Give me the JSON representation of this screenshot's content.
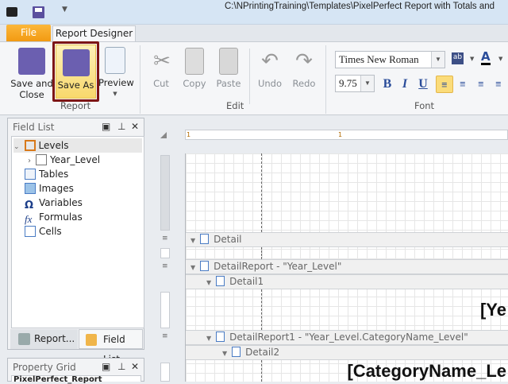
{
  "titlebar": {
    "title": "C:\\NPrintingTraining\\Templates\\PixelPerfect Report with Totals and"
  },
  "tabs": {
    "file": "File",
    "report_designer": "Report Designer"
  },
  "ribbon": {
    "report_group": {
      "label": "Report",
      "save_and_close": "Save and Close",
      "save_as": "Save As",
      "preview": "Preview"
    },
    "edit_group": {
      "label": "Edit",
      "cut": "Cut",
      "copy": "Copy",
      "paste": "Paste",
      "undo": "Undo",
      "redo": "Redo"
    },
    "font_group": {
      "label": "Font",
      "font_name": "Times New Roman",
      "font_size": "9.75",
      "bold": "B",
      "italic": "I",
      "underline": "U",
      "color_letter": "A",
      "highlight": "ab"
    }
  },
  "field_list": {
    "title": "Field List",
    "items": [
      "Levels",
      "Year_Level",
      "Tables",
      "Images",
      "Variables",
      "Formulas",
      "Cells"
    ],
    "tab_report": "Report...",
    "tab_field_list": "Field List"
  },
  "property_grid": {
    "title": "Property Grid",
    "selected": "PixelPerfect_Report"
  },
  "designer": {
    "ruler_marks": [
      "1",
      "1"
    ],
    "bands": [
      "Detail",
      "DetailReport - \"Year_Level\"",
      "Detail1",
      "DetailReport1 - \"Year_Level.CategoryName_Level\"",
      "Detail2"
    ],
    "year_field": "[Ye",
    "category_field": "[CategoryName_Le"
  }
}
